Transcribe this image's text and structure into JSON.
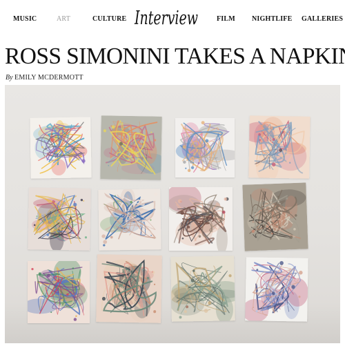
{
  "nav": {
    "items": [
      {
        "label": "MUSIC",
        "active": false
      },
      {
        "label": "ART",
        "active": true
      },
      {
        "label": "CULTURE",
        "active": false
      },
      {
        "label": "FILM",
        "active": false
      },
      {
        "label": "NIGHTLIFE",
        "active": false
      },
      {
        "label": "GALLERIES",
        "active": false
      }
    ],
    "logo": "Interview"
  },
  "article": {
    "title": "ROSS SIMONINI TAKES A NAPKIN",
    "byline_prefix": "By",
    "author": "EMILY MCDERMOTT"
  },
  "colors": {
    "text": "#111111",
    "nav_active": "#9a9a9a",
    "wall": "#e6e4e1"
  },
  "hero": {
    "napkins": [
      {
        "palette": [
          "#e8625a",
          "#8a6cc0",
          "#f0c24f",
          "#58a7c8",
          "#6b6b6b"
        ],
        "base": "#f4f1ec"
      },
      {
        "palette": [
          "#6d6f63",
          "#e58f62",
          "#c56d8a",
          "#e9d65a",
          "#7ea3b4"
        ],
        "base": "#b7b7ad"
      },
      {
        "palette": [
          "#8c6fb2",
          "#e28aa8",
          "#5d8fc4",
          "#a7a7a7",
          "#e5b27a"
        ],
        "base": "#f2f0ee"
      },
      {
        "palette": [
          "#e9a07b",
          "#5f4f57",
          "#c7607a",
          "#f2c7a6",
          "#7f9fbe"
        ],
        "base": "#f1ddce"
      },
      {
        "palette": [
          "#5c84c4",
          "#e8b74a",
          "#c2566f",
          "#70b38a",
          "#3e3a4a"
        ],
        "base": "#e7ded9"
      },
      {
        "palette": [
          "#d7b6a9",
          "#3d6fae",
          "#6aa05f",
          "#c9a08f",
          "#f0e6df"
        ],
        "base": "#eee7e1"
      },
      {
        "palette": [
          "#6f4b42",
          "#b3475c",
          "#8a7b6b",
          "#e5b7a2",
          "#4d4d55"
        ],
        "base": "#f2efec"
      },
      {
        "palette": [
          "#7d7062",
          "#4b4541",
          "#c58a73",
          "#9f9a8d",
          "#d4cab9"
        ],
        "base": "#a9a193"
      },
      {
        "palette": [
          "#d6455a",
          "#3f8a5c",
          "#e9b352",
          "#5a7bc1",
          "#7c4c8f"
        ],
        "base": "#efe1d9"
      },
      {
        "palette": [
          "#e3a093",
          "#6b8a7a",
          "#c88c6f",
          "#3e4a53",
          "#e7cfb3"
        ],
        "base": "#e9d5c8"
      },
      {
        "palette": [
          "#8ca392",
          "#c0a574",
          "#5e6f69",
          "#dfc6a6",
          "#a26f5e"
        ],
        "base": "#e6e0d2"
      },
      {
        "palette": [
          "#7f8fc8",
          "#c76f8a",
          "#4f5b8c",
          "#d5a38f",
          "#b8c7e4"
        ],
        "base": "#f3f2ef"
      }
    ]
  }
}
